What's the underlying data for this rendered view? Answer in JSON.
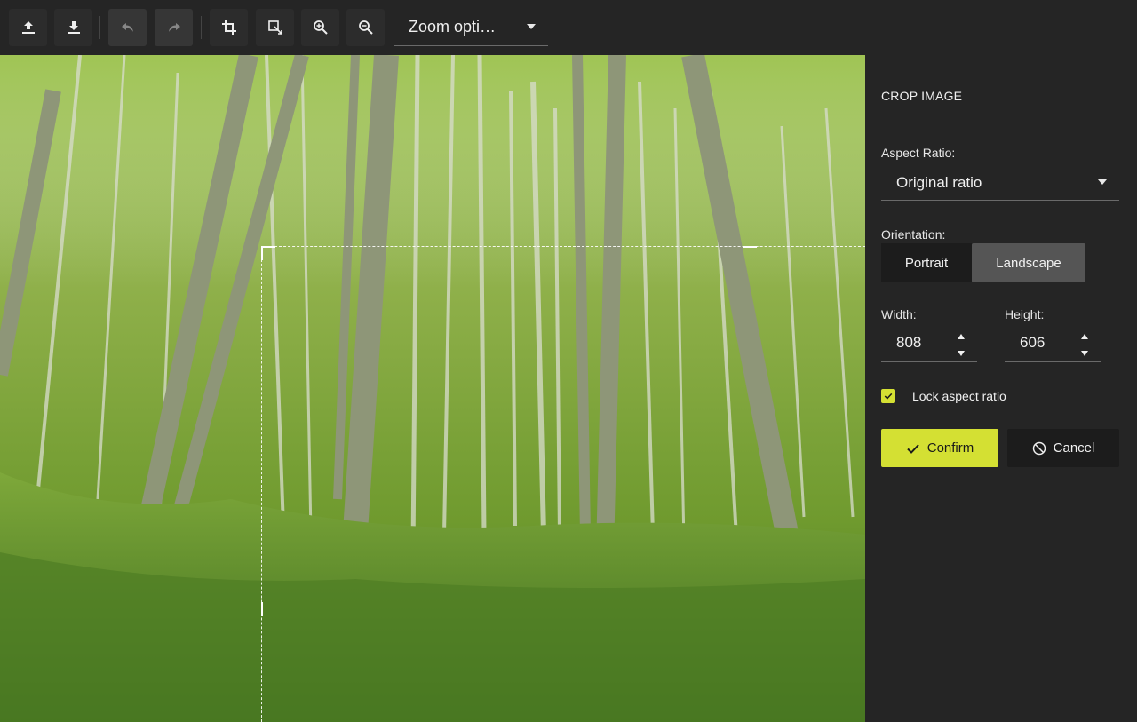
{
  "toolbar": {
    "buttons": [
      {
        "name": "upload-icon"
      },
      {
        "name": "download-icon"
      },
      {
        "name": "undo-icon"
      },
      {
        "name": "redo-icon"
      },
      {
        "name": "crop-icon"
      },
      {
        "name": "resize-icon"
      },
      {
        "name": "zoom-in-icon"
      },
      {
        "name": "zoom-out-icon"
      }
    ],
    "zoom_label": "Zoom opti…"
  },
  "panel": {
    "title": "CROP IMAGE",
    "aspect_ratio_label": "Aspect Ratio:",
    "aspect_ratio_value": "Original ratio",
    "orientation_label": "Orientation:",
    "orientation_portrait": "Portrait",
    "orientation_landscape": "Landscape",
    "orientation_selected": "Landscape",
    "width_label": "Width:",
    "width_value": "808",
    "height_label": "Height:",
    "height_value": "606",
    "lock_label": "Lock aspect ratio",
    "lock_checked": true,
    "confirm_label": "Confirm",
    "cancel_label": "Cancel"
  },
  "colors": {
    "accent": "#d4e033",
    "background": "#252525",
    "selected_segment": "#555555"
  }
}
